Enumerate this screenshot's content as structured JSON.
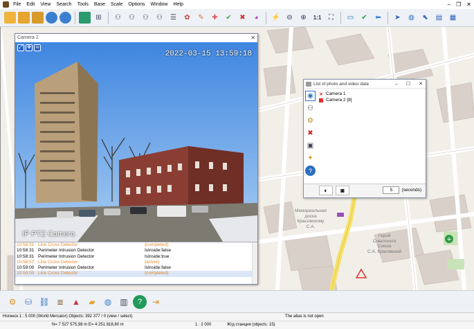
{
  "menu": [
    "File",
    "Edit",
    "View",
    "Search",
    "Tools",
    "Base",
    "Scale",
    "Options",
    "Window",
    "Help"
  ],
  "window_controls": [
    "–",
    "❐",
    "✕"
  ],
  "toolbar": {
    "zoom_label": "1:1"
  },
  "map": {
    "labels": [
      "Мемориальная",
      "доска",
      "Красовскому",
      "С.А.",
      "Герой",
      "Советского",
      "Союза",
      "С.А. Красовский"
    ]
  },
  "camera_window": {
    "title": "Camera 2",
    "close": "✕",
    "timestamp": "2022-03-15 13:59:18",
    "overlay_label": "IP PTZ Camera",
    "log": [
      {
        "time": "10:58:31",
        "event": "Line Cross Detector",
        "state": "{completed}",
        "style": "warn"
      },
      {
        "time": "10:58:31",
        "event": "Perimeter Intrusion Detector",
        "state": "IsInside:false",
        "style": "normal"
      },
      {
        "time": "10:58:31",
        "event": "Perimeter Intrusion Detector",
        "state": "IsInside:true",
        "style": "normal"
      },
      {
        "time": "10:58:57",
        "event": "Line Cross Detector",
        "state": "{active}",
        "style": "warn"
      },
      {
        "time": "10:59:00",
        "event": "Perimeter Intrusion Detector",
        "state": "IsInside:false",
        "style": "normal"
      },
      {
        "time": "10:59:00",
        "event": "Line Cross Detector",
        "state": "{completed}",
        "style": "sel"
      }
    ]
  },
  "pv_window": {
    "title": "List of photo and video data",
    "controls": [
      "–",
      "☐",
      "✕"
    ],
    "items": [
      {
        "label": "Camera 1",
        "marker": "x"
      },
      {
        "label": "Camera 2 [8]",
        "marker": "square"
      }
    ],
    "seconds_value": "5",
    "seconds_label": "(seconds)"
  },
  "status": {
    "line1_left": "Ногинск  1 : 5 000 (World Mercator)  Objects: 392 377 / 0 (view / select)",
    "line1_right": "The atlas is not open",
    "line2_coords": "N= 7 527 575,98 m    E= 4 251 818,80 m",
    "line2_scale": "1 : 2 000",
    "line2_layer": "Ж/д станции   (objects: 15)"
  },
  "colors": {
    "toolbar_bg": "#eef1f6",
    "map_bg": "#f2efe9",
    "road": "#ffffff",
    "main_road": "#f7e26b",
    "building": "#d9d0c9",
    "warn_text": "#e2882a",
    "selection": "#dbe6f7"
  }
}
